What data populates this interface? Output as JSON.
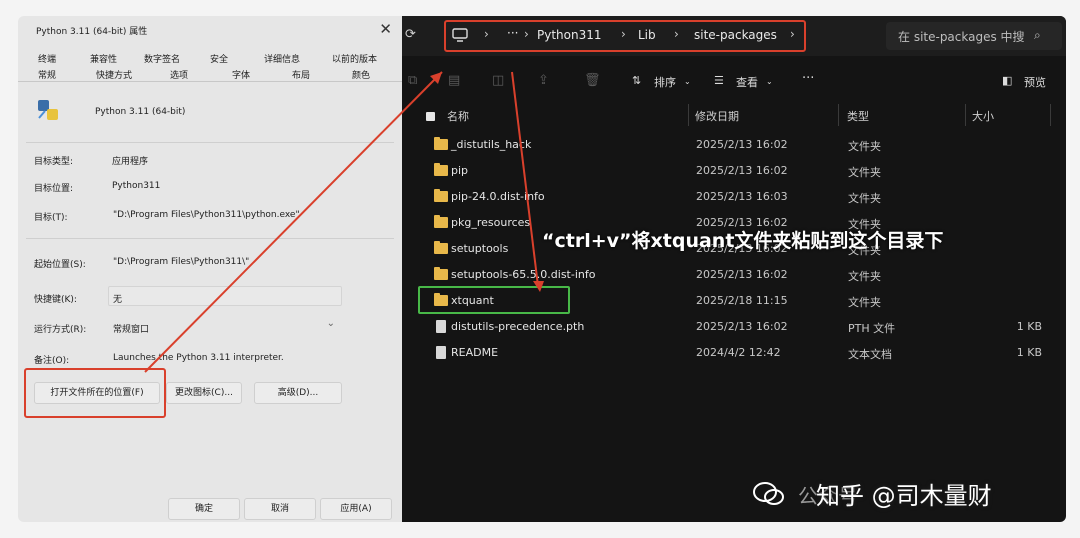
{
  "props": {
    "title": "Python 3.11 (64-bit) 属性",
    "close": "✕",
    "tabs_row1": [
      "终端",
      "兼容性",
      "数字签名",
      "安全",
      "详细信息",
      "以前的版本"
    ],
    "tabs_row2": [
      "常规",
      "快捷方式",
      "选项",
      "字体",
      "布局",
      "颜色"
    ],
    "app_name": "Python 3.11 (64-bit)",
    "target_type_label": "目标类型:",
    "target_type_value": "应用程序",
    "target_location_label": "目标位置:",
    "target_location_value": "Python311",
    "target_label": "目标(T):",
    "target_value": "\"D:\\Program Files\\Python311\\python.exe\"",
    "start_in_label": "起始位置(S):",
    "start_in_value": "\"D:\\Program Files\\Python311\\\"",
    "shortcut_key_label": "快捷键(K):",
    "shortcut_key_value": "无",
    "run_label": "运行方式(R):",
    "run_value": "常规窗口",
    "comment_label": "备注(O):",
    "comment_value": "Launches the Python 3.11 interpreter.",
    "btn_open_location": "打开文件所在的位置(F)",
    "btn_change_icon": "更改图标(C)...",
    "btn_advanced": "高级(D)...",
    "btn_ok": "确定",
    "btn_cancel": "取消",
    "btn_apply": "应用(A)"
  },
  "explorer": {
    "breadcrumb": [
      "Python311",
      "Lib",
      "site-packages"
    ],
    "more": "···",
    "search_placeholder": "在 site-packages 中搜",
    "toolbar": {
      "sort": "排序",
      "view": "查看",
      "more": "···",
      "preview": "预览"
    },
    "columns": {
      "name": "名称",
      "date": "修改日期",
      "type": "类型",
      "size": "大小"
    },
    "rows": [
      {
        "name": "_distutils_hack",
        "date": "2025/2/13 16:02",
        "type": "文件夹",
        "size": "",
        "kind": "folder"
      },
      {
        "name": "pip",
        "date": "2025/2/13 16:02",
        "type": "文件夹",
        "size": "",
        "kind": "folder"
      },
      {
        "name": "pip-24.0.dist-info",
        "date": "2025/2/13 16:03",
        "type": "文件夹",
        "size": "",
        "kind": "folder"
      },
      {
        "name": "pkg_resources",
        "date": "2025/2/13 16:02",
        "type": "文件夹",
        "size": "",
        "kind": "folder"
      },
      {
        "name": "setuptools",
        "date": "2025/2/13 16:02",
        "type": "文件夹",
        "size": "",
        "kind": "folder"
      },
      {
        "name": "setuptools-65.5.0.dist-info",
        "date": "2025/2/13 16:02",
        "type": "文件夹",
        "size": "",
        "kind": "folder"
      },
      {
        "name": "xtquant",
        "date": "2025/2/18 11:15",
        "type": "文件夹",
        "size": "",
        "kind": "folder"
      },
      {
        "name": "distutils-precedence.pth",
        "date": "2025/2/13 16:02",
        "type": "PTH 文件",
        "size": "1 KB",
        "kind": "file"
      },
      {
        "name": "README",
        "date": "2024/4/2 12:42",
        "type": "文本文档",
        "size": "1 KB",
        "kind": "file"
      }
    ]
  },
  "annotation": "“ctrl+v”将xtquant文件夹粘贴到这个目录下",
  "watermark": {
    "gray": "公众号",
    "text": "知乎 @司木量财"
  },
  "colors": {
    "highlight_red": "#d9402c",
    "highlight_green": "#48b848",
    "folder": "#e8b84a",
    "explorer_bg": "#141414"
  }
}
